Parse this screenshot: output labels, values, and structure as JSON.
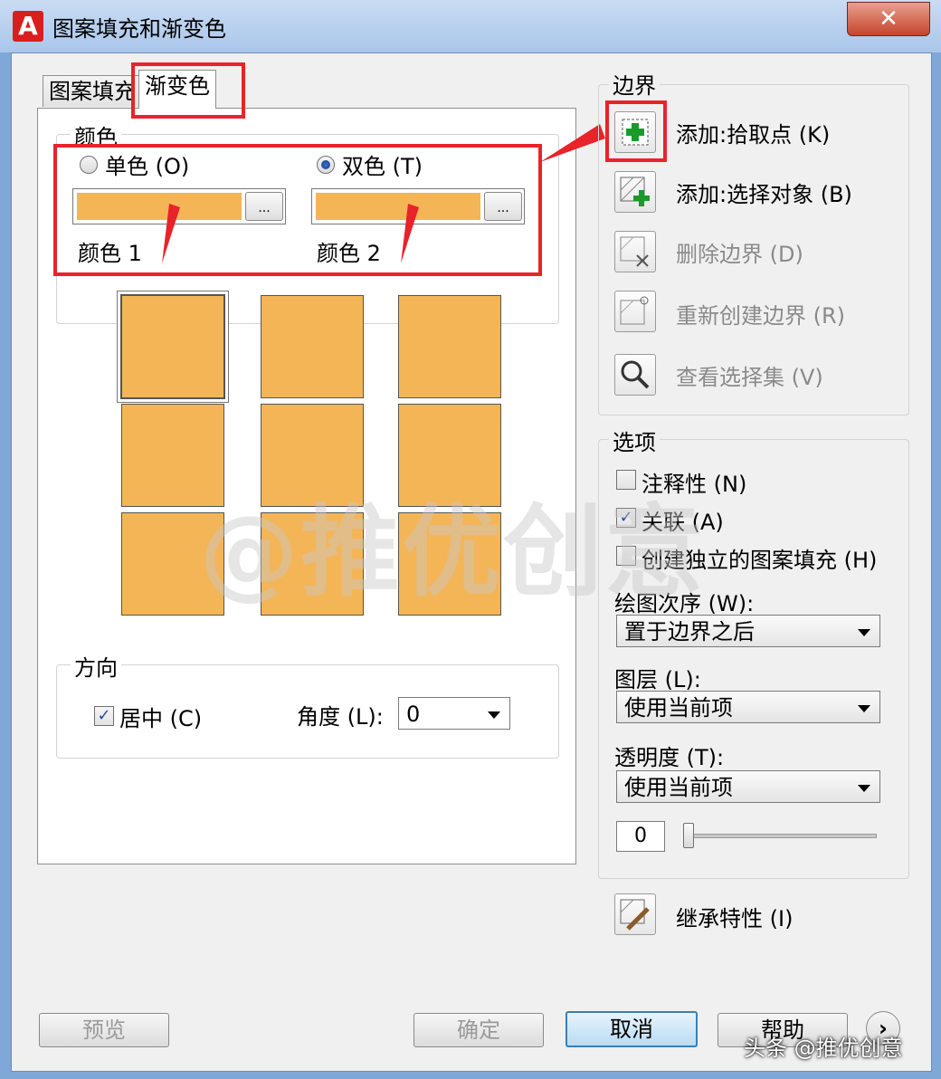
{
  "window": {
    "title": "图案填充和渐变色",
    "close_symbol": "✕"
  },
  "tabs": [
    {
      "label": "图案填充"
    },
    {
      "label": "渐变色"
    }
  ],
  "color_group": {
    "legend": "颜色",
    "single": {
      "label": "单色 (O)",
      "selected": false
    },
    "dual": {
      "label": "双色 (T)",
      "selected": true
    },
    "color1_label": "颜色 1",
    "color2_label": "颜色 2",
    "button_label": "...",
    "swatch_color": "#f4b557"
  },
  "direction_group": {
    "legend": "方向",
    "center_label": "居中 (C)",
    "center_checked": true,
    "angle_label": "角度 (L):",
    "angle_value": "0"
  },
  "boundary_group": {
    "legend": "边界",
    "items": [
      {
        "label": "添加:拾取点 (K)",
        "enabled": true,
        "icon": "pick-point-icon"
      },
      {
        "label": "添加:选择对象 (B)",
        "enabled": true,
        "icon": "select-objects-icon"
      },
      {
        "label": "删除边界 (D)",
        "enabled": false,
        "icon": "remove-boundary-icon"
      },
      {
        "label": "重新创建边界 (R)",
        "enabled": false,
        "icon": "recreate-boundary-icon"
      },
      {
        "label": "查看选择集 (V)",
        "enabled": false,
        "icon": "magnifier-icon"
      }
    ]
  },
  "options_group": {
    "legend": "选项",
    "annotative": {
      "label": "注释性 (N)",
      "checked": false
    },
    "associative": {
      "label": "关联 (A)",
      "checked": true
    },
    "separate": {
      "label": "创建独立的图案填充 (H)",
      "checked": false
    },
    "draw_order_label": "绘图次序 (W):",
    "draw_order_value": "置于边界之后",
    "layer_label": "图层 (L):",
    "layer_value": "使用当前项",
    "transparency_label": "透明度 (T):",
    "transparency_value": "使用当前项",
    "transparency_number": "0"
  },
  "inherit": {
    "label": "继承特性 (I)",
    "icon": "inherit-properties-icon"
  },
  "footer": {
    "preview": "预览",
    "ok": "确定",
    "cancel": "取消",
    "help": "帮助",
    "more_symbol": "›"
  },
  "watermark": "@推优创意",
  "credit": "头条 @推优创意"
}
